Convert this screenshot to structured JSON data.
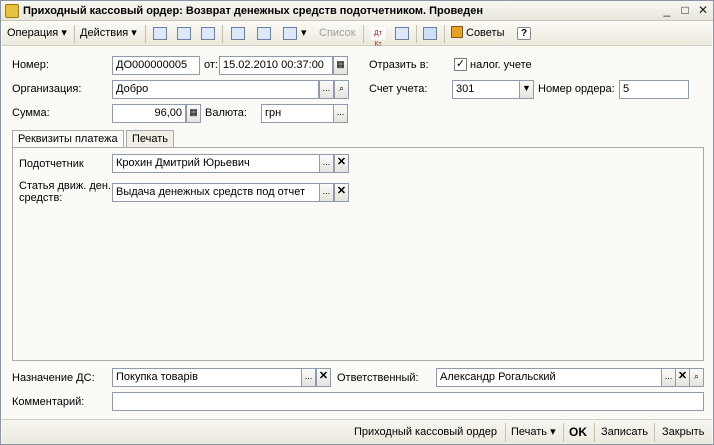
{
  "window": {
    "title": "Приходный кассовый ордер: Возврат денежных средств подотчетником. Проведен",
    "minimize": "_",
    "maximize": "□",
    "close": "✕"
  },
  "toolbar": {
    "operation": "Операция ▾",
    "actions": "Действия ▾",
    "list": "Список",
    "dtkt": "Дт Кт",
    "tips": "Советы",
    "help": "?"
  },
  "form": {
    "number_label": "Номер:",
    "number_value": "ДО000000005",
    "from_label": "от:",
    "date_value": "15.02.2010 00:37:00",
    "reflect_label": "Отразить в:",
    "tax_checkbox_label": "налог. учете",
    "tax_checked": "✓",
    "org_label": "Организация:",
    "org_value": "Добро",
    "account_label": "Счет учета:",
    "account_value": "301",
    "order_number_label": "Номер ордера:",
    "order_number_value": "5",
    "sum_label": "Сумма:",
    "sum_value": "96,00",
    "currency_label": "Валюта:",
    "currency_value": "грн"
  },
  "tabs": {
    "payment": "Реквизиты платежа",
    "print": "Печать"
  },
  "payment": {
    "accountable_label": "Подотчетник",
    "accountable_value": "Крохин Дмитрий Юрьевич",
    "cashflow_label_line1": "Статья движ. ден.",
    "cashflow_label_line2": "средств:",
    "cashflow_value": "Выдача денежных средств под отчет"
  },
  "bottom": {
    "purpose_label": "Назначение ДС:",
    "purpose_value": "Покупка товарів",
    "responsible_label": "Ответственный:",
    "responsible_value": "Александр Рогальский",
    "comment_label": "Комментарий:",
    "comment_value": ""
  },
  "statusbar": {
    "cash_order": "Приходный кассовый ордер",
    "print": "Печать ▾",
    "ok": "OK",
    "save": "Записать",
    "close": "Закрыть"
  },
  "buttons": {
    "ellipsis": "...",
    "clear": "✕",
    "search": "⌕",
    "dropdown": "▼",
    "calendar": "▦",
    "calculator": "▦"
  }
}
